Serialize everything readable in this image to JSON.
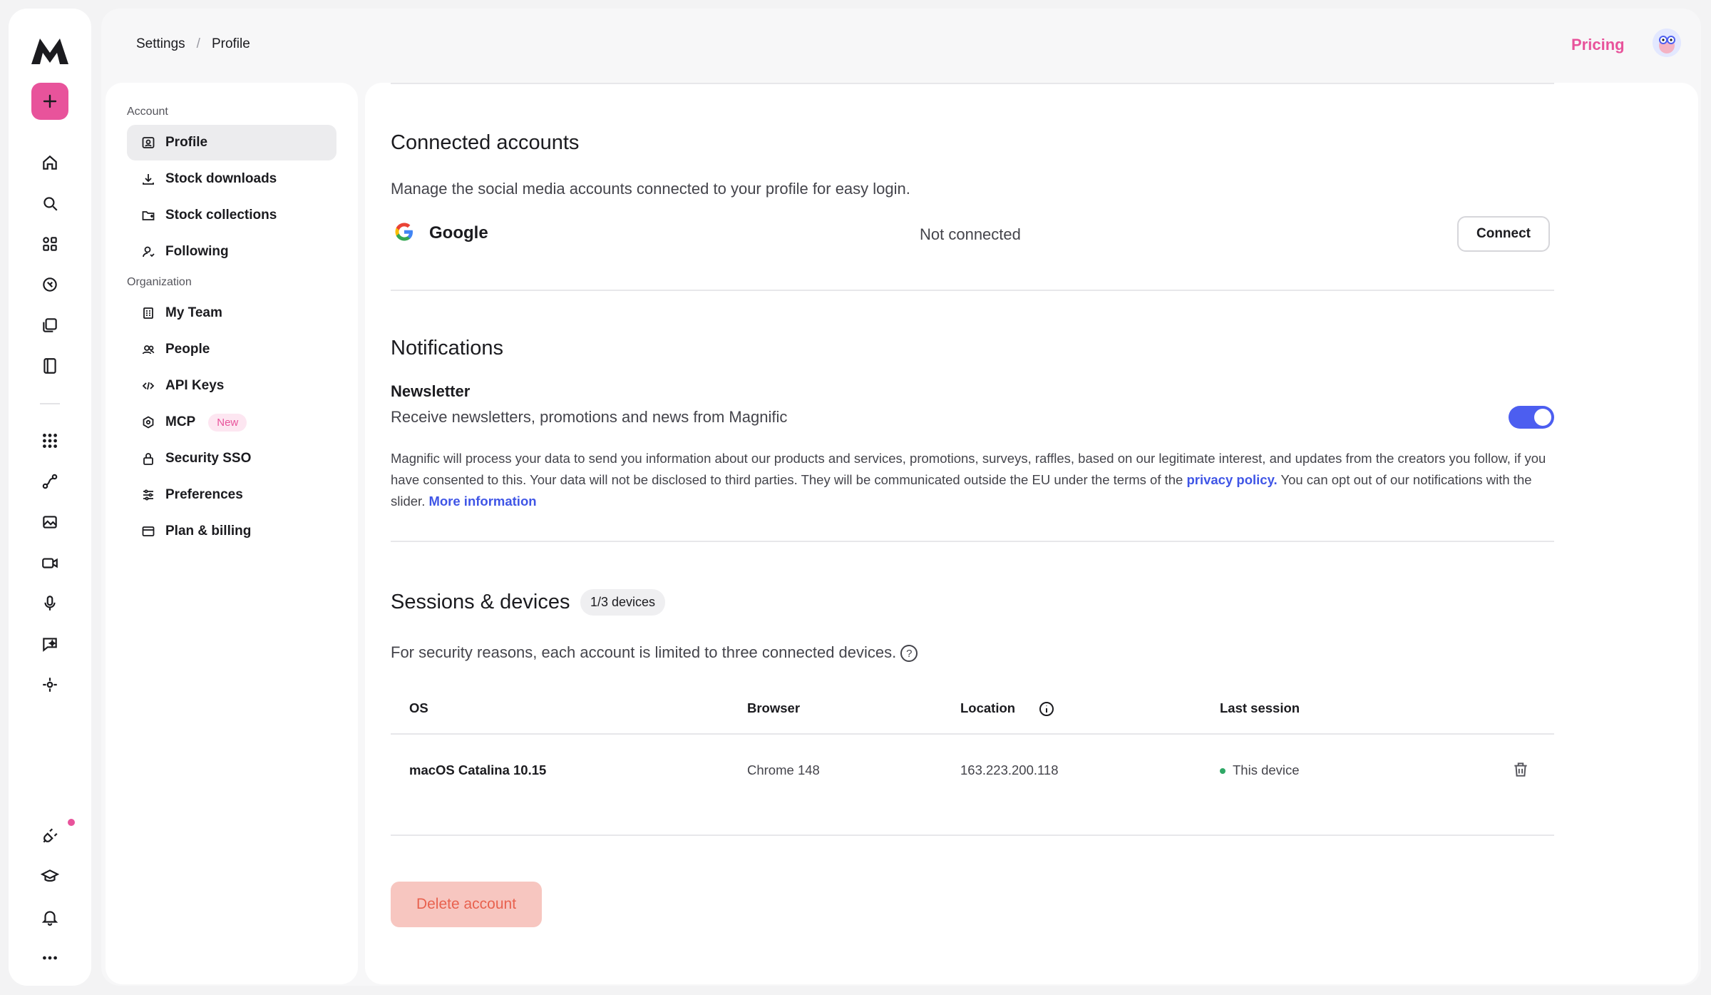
{
  "brand": {
    "accent": "#e8539b",
    "toggle_color": "#4c5ef0",
    "link_color": "#3f55e6"
  },
  "rail": {
    "icons": [
      "logo-icon",
      "plus-icon",
      "home-icon",
      "search-icon",
      "apps-icon",
      "stock-icon",
      "library-icon",
      "book-icon",
      "grid-icon",
      "pipeline-icon",
      "image-icon",
      "video-icon",
      "mic-icon",
      "assistant-icon",
      "nodes-icon",
      "plugin-icon",
      "academy-icon",
      "bell-icon",
      "more-icon"
    ]
  },
  "header": {
    "crumb_1": "Settings",
    "crumb_sep": "/",
    "crumb_2": "Profile",
    "pricing": "Pricing"
  },
  "sidebar": {
    "group_account": "Account",
    "group_org": "Organization",
    "items": [
      {
        "label": "Profile",
        "icon": "profile-icon",
        "active": true
      },
      {
        "label": "Stock downloads",
        "icon": "download-icon"
      },
      {
        "label": "Stock collections",
        "icon": "folder-icon"
      },
      {
        "label": "Following",
        "icon": "user-follow-icon"
      },
      {
        "label": "My Team",
        "icon": "building-icon"
      },
      {
        "label": "People",
        "icon": "people-icon"
      },
      {
        "label": "API Keys",
        "icon": "code-icon"
      },
      {
        "label": "MCP",
        "icon": "mcp-icon",
        "tag": "New"
      },
      {
        "label": "Security SSO",
        "icon": "lock-icon"
      },
      {
        "label": "Preferences",
        "icon": "sliders-icon"
      },
      {
        "label": "Plan & billing",
        "icon": "card-icon"
      }
    ]
  },
  "connected": {
    "title": "Connected accounts",
    "desc": "Manage the social media accounts connected to your profile for easy login.",
    "provider": "Google",
    "status": "Not connected",
    "button": "Connect"
  },
  "notifications": {
    "title": "Notifications",
    "newsletter_title": "Newsletter",
    "newsletter_desc": "Receive newsletters, promotions and news from Magnific",
    "newsletter_on": true,
    "legal_1": "Magnific will process your data to send you information about our products and services, promotions, surveys, raffles, based on our legitimate interest, and updates from the creators you follow, if you have consented to this. Your data will not be disclosed to third parties. They will be communicated outside the EU under the terms of the ",
    "legal_link_1": "privacy policy.",
    "legal_2": " You can opt out of our notifications with the slider. ",
    "legal_link_2": "More information"
  },
  "sessions": {
    "title": "Sessions & devices",
    "badge": "1/3 devices",
    "desc": "For security reasons, each account is limited to three connected devices.",
    "help": "?",
    "columns": {
      "os": "OS",
      "browser": "Browser",
      "location": "Location",
      "last": "Last session"
    },
    "row": {
      "os": "macOS Catalina 10.15",
      "browser": "Chrome 148",
      "location": "163.223.200.118",
      "last": "This device"
    }
  },
  "danger": {
    "delete_label": "Delete account"
  }
}
